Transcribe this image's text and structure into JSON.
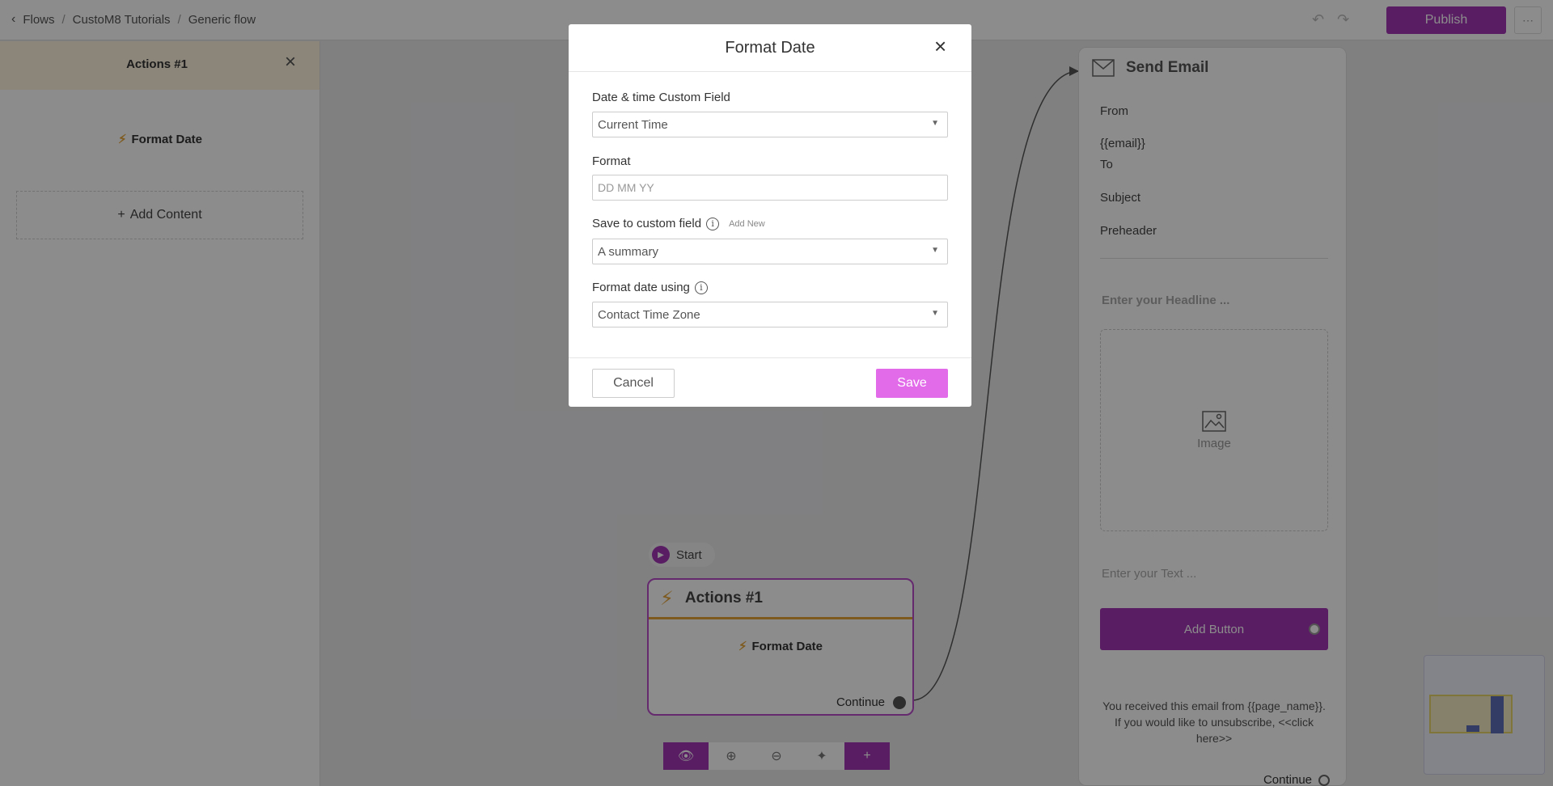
{
  "breadcrumb": {
    "items": [
      "Flows",
      "CustoM8 Tutorials",
      "Generic flow"
    ]
  },
  "topbar": {
    "publish_label": "Publish",
    "more_label": "⋯",
    "undo_icon": "undo-icon",
    "redo_icon": "redo-icon"
  },
  "left_panel": {
    "title": "Actions #1",
    "item_label": "Format Date",
    "add_content_label": "Add Content"
  },
  "canvas": {
    "start_label": "Start",
    "action_node": {
      "title": "Actions #1",
      "item_label": "Format Date",
      "continue_label": "Continue"
    }
  },
  "email_card": {
    "title": "Send Email",
    "from_label": "From",
    "from_value": "{{email}}",
    "to_label": "To",
    "subject_label": "Subject",
    "preheader_label": "Preheader",
    "headline_placeholder": "Enter your Headline ...",
    "image_label": "Image",
    "text_placeholder": "Enter your Text ...",
    "button_label": "Add Button",
    "footer_text": "You received this email from {{page_name}}. If you would like to unsubscribe, <<click here>>",
    "continue_label": "Continue"
  },
  "modal": {
    "title": "Format Date",
    "field1_label": "Date & time Custom Field",
    "field1_value": "Current Time",
    "field2_label": "Format",
    "field2_placeholder": "DD MM YY",
    "field3_label": "Save to custom field",
    "field3_add_new": "Add New",
    "field3_value": "A summary",
    "field4_label": "Format date using",
    "field4_value": "Contact Time Zone",
    "cancel_label": "Cancel",
    "save_label": "Save"
  },
  "colors": {
    "accent": "#a235b5",
    "save": "#e26be9",
    "action_underline": "#e5a53a"
  }
}
